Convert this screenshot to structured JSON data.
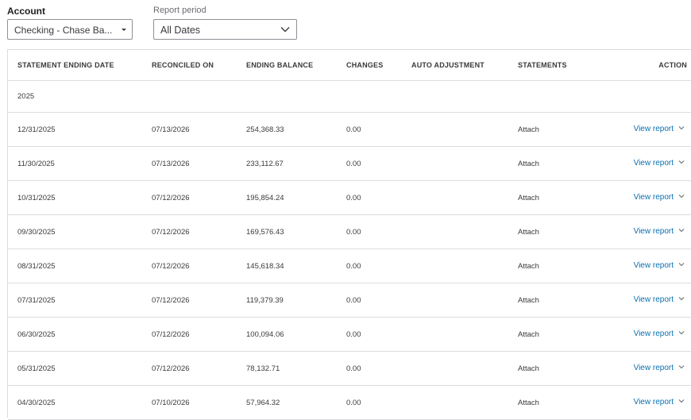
{
  "filters": {
    "account_label": "Account",
    "account_value": "Checking - Chase Ba...",
    "period_label": "Report period",
    "period_value": "All Dates"
  },
  "table": {
    "headers": [
      "STATEMENT ENDING DATE",
      "RECONCILED ON",
      "ENDING BALANCE",
      "CHANGES",
      "AUTO ADJUSTMENT",
      "STATEMENTS",
      "ACTION"
    ],
    "group": "2025",
    "rows": [
      {
        "ending_date": "12/31/2025",
        "reconciled_on": "07/13/2026",
        "ending_balance": "254,368.33",
        "changes": "0.00",
        "auto_adjustment": "",
        "statements": "Attach",
        "action": "View report"
      },
      {
        "ending_date": "11/30/2025",
        "reconciled_on": "07/13/2026",
        "ending_balance": "233,112.67",
        "changes": "0.00",
        "auto_adjustment": "",
        "statements": "Attach",
        "action": "View report"
      },
      {
        "ending_date": "10/31/2025",
        "reconciled_on": "07/12/2026",
        "ending_balance": "195,854.24",
        "changes": "0.00",
        "auto_adjustment": "",
        "statements": "Attach",
        "action": "View report"
      },
      {
        "ending_date": "09/30/2025",
        "reconciled_on": "07/12/2026",
        "ending_balance": "169,576.43",
        "changes": "0.00",
        "auto_adjustment": "",
        "statements": "Attach",
        "action": "View report"
      },
      {
        "ending_date": "08/31/2025",
        "reconciled_on": "07/12/2026",
        "ending_balance": "145,618.34",
        "changes": "0.00",
        "auto_adjustment": "",
        "statements": "Attach",
        "action": "View report"
      },
      {
        "ending_date": "07/31/2025",
        "reconciled_on": "07/12/2026",
        "ending_balance": "119,379.39",
        "changes": "0.00",
        "auto_adjustment": "",
        "statements": "Attach",
        "action": "View report"
      },
      {
        "ending_date": "06/30/2025",
        "reconciled_on": "07/12/2026",
        "ending_balance": "100,094.06",
        "changes": "0.00",
        "auto_adjustment": "",
        "statements": "Attach",
        "action": "View report"
      },
      {
        "ending_date": "05/31/2025",
        "reconciled_on": "07/12/2026",
        "ending_balance": "78,132.71",
        "changes": "0.00",
        "auto_adjustment": "",
        "statements": "Attach",
        "action": "View report"
      },
      {
        "ending_date": "04/30/2025",
        "reconciled_on": "07/10/2026",
        "ending_balance": "57,964.32",
        "changes": "0.00",
        "auto_adjustment": "",
        "statements": "Attach",
        "action": "View report"
      }
    ]
  },
  "colors": {
    "link": "#0b6fb0",
    "border": "#dcdcdf",
    "text": "#393a3d"
  },
  "icons": {
    "account_caret": "caret-down-icon",
    "period_chevron": "chevron-down-icon",
    "action_chevron": "chevron-down-icon"
  }
}
